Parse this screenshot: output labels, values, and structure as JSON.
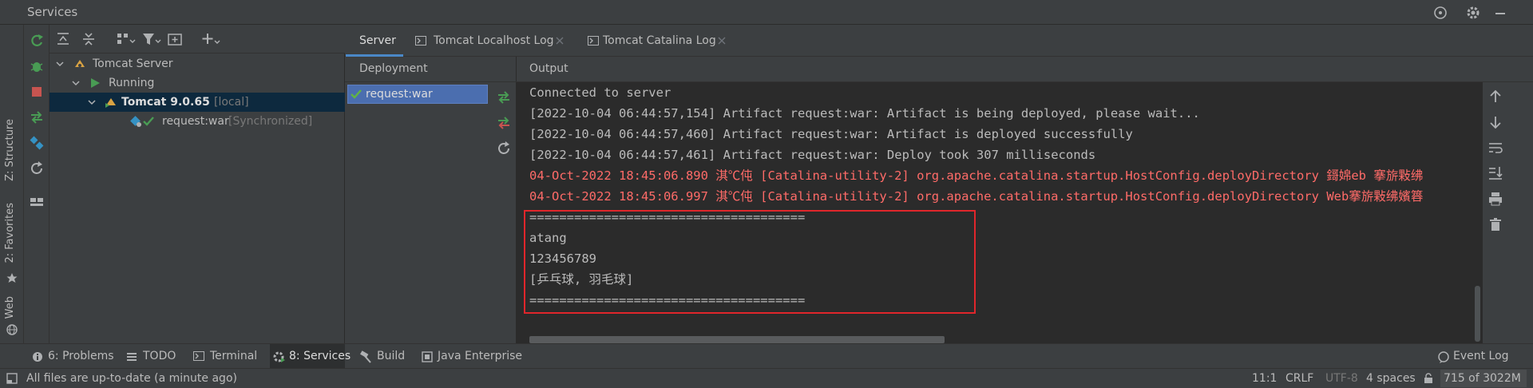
{
  "window": {
    "title": "Services"
  },
  "left_strip": {
    "structure": "Z: Structure",
    "favorites": "2: Favorites",
    "web": "Web"
  },
  "tree": {
    "server": "Tomcat Server",
    "running": "Running",
    "instance": "Tomcat 9.0.65",
    "instance_tag": "[local]",
    "artifact": "request:war",
    "artifact_tag": "[Synchronized]"
  },
  "tabs": [
    "Server",
    "Tomcat Localhost Log",
    "Tomcat Catalina Log"
  ],
  "deployment": {
    "header": "Deployment",
    "item": "request:war"
  },
  "output": {
    "header": "Output",
    "lines": [
      "Connected to server",
      "[2022-10-04 06:44:57,154] Artifact request:war: Artifact is being deployed, please wait...",
      "[2022-10-04 06:44:57,460] Artifact request:war: Artifact is deployed successfully",
      "[2022-10-04 06:44:57,461] Artifact request:war: Deploy took 307 milliseconds",
      "04-Oct-2022 18:45:06.890 淇℃伅 [Catalina-utility-2] org.apache.catalina.startup.HostConfig.deployDirectory 鎶婂eb 搴旂敤绋",
      "04-Oct-2022 18:45:06.997 淇℃伅 [Catalina-utility-2] org.apache.catalina.startup.HostConfig.deployDirectory Web搴旂敤绋嬪簭",
      "=====================================",
      "atang",
      "123456789",
      "[乒乓球, 羽毛球]",
      "====================================="
    ]
  },
  "bottom_tabs": {
    "problems": "6: Problems",
    "todo": "TODO",
    "terminal": "Terminal",
    "services": "8: Services",
    "build": "Build",
    "java_enterprise": "Java Enterprise",
    "event_log": "Event Log"
  },
  "status": {
    "message": "All files are up-to-date (a minute ago)",
    "position": "11:1",
    "line_sep": "CRLF",
    "encoding": "UTF-8",
    "indent": "4 spaces",
    "memory": "715 of 3022M"
  },
  "colors": {
    "accent": "#4a88c7",
    "run_green": "#499c54",
    "error_red": "#ff6b68",
    "highlight_box": "#e0262b"
  }
}
